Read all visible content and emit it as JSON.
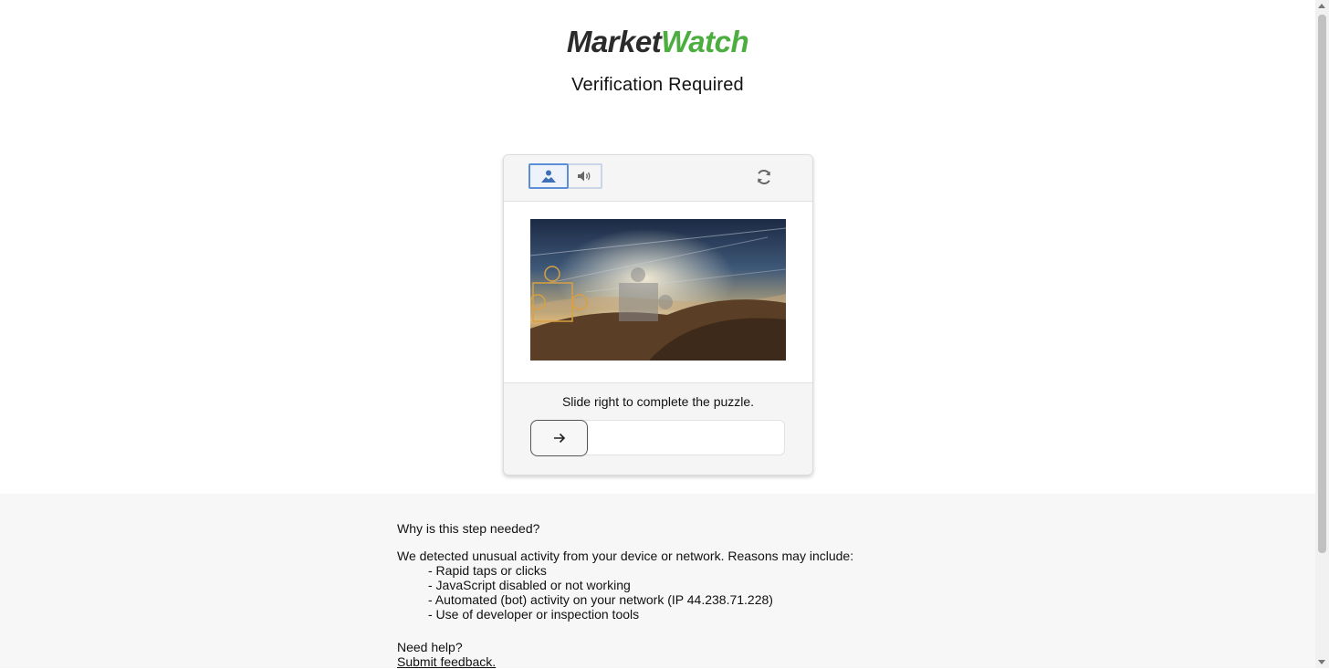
{
  "brand": {
    "part1": "Market",
    "part2": "Watch",
    "accent_color": "#4bae3f"
  },
  "page": {
    "title": "Verification Required"
  },
  "captcha": {
    "modes": [
      {
        "icon": "image-icon",
        "selected": true
      },
      {
        "icon": "audio-icon",
        "selected": false
      }
    ],
    "refresh_icon": "refresh-icon",
    "instruction": "Slide right to complete the puzzle.",
    "slider_icon": "arrow-right-icon",
    "slider_progress": 0
  },
  "info": {
    "why_heading": "Why is this step needed?",
    "detected": "We detected unusual activity from your device or network. Reasons may include:",
    "reasons": [
      "- Rapid taps or clicks",
      "- JavaScript disabled or not working",
      "- Automated (bot) activity on your network (IP 44.238.71.228)",
      "- Use of developer or inspection tools"
    ],
    "need_help": "Need help?",
    "feedback_link": "Submit feedback."
  }
}
